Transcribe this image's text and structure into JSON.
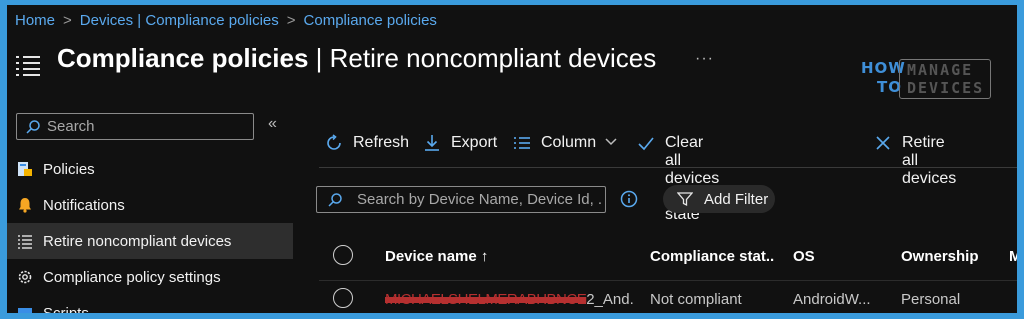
{
  "breadcrumb": {
    "items": [
      "Home",
      "Devices | Compliance policies",
      "Compliance policies"
    ],
    "separator": ">"
  },
  "header": {
    "title_bold": "Compliance policies",
    "title_rest": " | Retire noncompliant devices",
    "more": "···"
  },
  "logo": {
    "how": "HOW",
    "to": "TO",
    "manage": "MANAGE",
    "devices": "DEVICES"
  },
  "sidebar": {
    "search_placeholder": "Search",
    "collapse": "«",
    "items": [
      {
        "label": "Policies",
        "icon": "policies-icon",
        "active": false
      },
      {
        "label": "Notifications",
        "icon": "bell-icon",
        "active": false
      },
      {
        "label": "Retire noncompliant devices",
        "icon": "list-icon",
        "active": true
      },
      {
        "label": "Compliance policy settings",
        "icon": "gear-icon",
        "active": false
      },
      {
        "label": "Scripts",
        "icon": "scripts-icon",
        "active": false
      }
    ]
  },
  "toolbar": {
    "refresh": "Refresh",
    "export": "Export",
    "column": "Column",
    "clear": "Clear all devices retire state",
    "retire": "Retire all devices"
  },
  "filter": {
    "search_placeholder": "Search by Device Name, Device Id, ...",
    "add_filter": "Add Filter"
  },
  "grid": {
    "columns": [
      "Device name ↑",
      "Compliance stat...",
      "OS",
      "Ownership",
      "M"
    ],
    "rows": [
      {
        "device_name_redacted": "MICHAELSHELMERABHBNCE",
        "device_name_visible": "2_And...",
        "compliance": "Not compliant",
        "os": "AndroidW...",
        "ownership": "Personal"
      }
    ]
  },
  "colors": {
    "accent": "#5aa9ee",
    "background": "#111111",
    "border_frame": "#3a9bdc",
    "active_nav": "#2e2e2e"
  }
}
